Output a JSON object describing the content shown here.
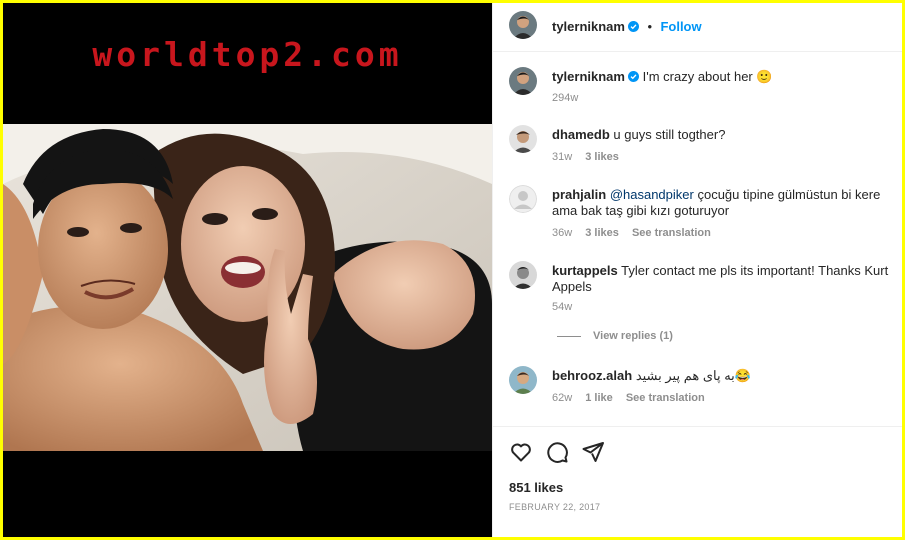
{
  "watermark": "worldtop2.com",
  "header": {
    "username": "tylerniknam",
    "separator": "•",
    "follow_label": "Follow"
  },
  "caption": {
    "username": "tylerniknam",
    "text": "I'm crazy about her 🙂",
    "time": "294w"
  },
  "comments": [
    {
      "username": "dhamedb",
      "text": "u guys still togther?",
      "time": "31w",
      "likes": "3 likes"
    },
    {
      "username": "prahjalin",
      "mention": "@hasandpiker",
      "text": "çocuğu tipine gülmüstun bi kere ama bak taş gibi kızı goturuyor",
      "time": "36w",
      "likes": "3 likes",
      "translate": "See translation"
    },
    {
      "username": "kurtappels",
      "text": "Tyler contact me pls its important! Thanks Kurt Appels",
      "time": "54w"
    },
    {
      "username": "behrooz.alah",
      "text": "به پای هم پیر بشید😂",
      "time": "62w",
      "likes": "1 like",
      "translate": "See translation"
    }
  ],
  "view_replies": "View replies (1)",
  "footer": {
    "likes": "851 likes",
    "date": "FEBRUARY 22, 2017"
  },
  "colors": {
    "accent": "#0095f6",
    "watermark": "#c8161d",
    "border": "#ffff00"
  },
  "icons": [
    "heart-icon",
    "comment-icon",
    "share-icon",
    "verified-icon"
  ]
}
